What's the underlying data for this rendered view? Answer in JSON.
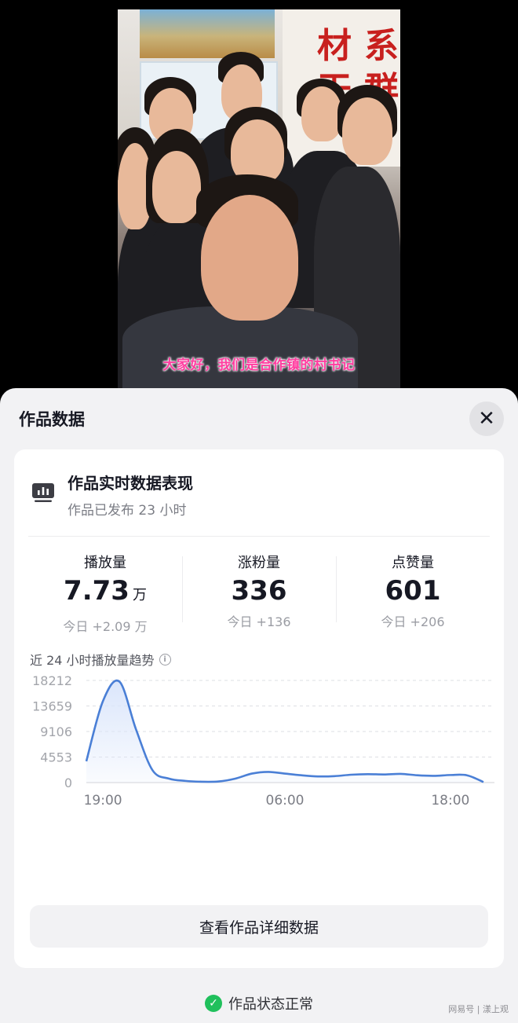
{
  "video": {
    "subtitle": "大家好，我们是合作镇的村书记"
  },
  "sheet": {
    "title": "作品数据",
    "close_icon": "close-icon"
  },
  "card": {
    "icon": "bar-chart-icon",
    "title": "作品实时数据表现",
    "subtitle": "作品已发布 23 小时"
  },
  "metrics": [
    {
      "label": "播放量",
      "value": "7.73",
      "unit": "万",
      "today": "今日 +2.09 万"
    },
    {
      "label": "涨粉量",
      "value": "336",
      "unit": "",
      "today": "今日 +136"
    },
    {
      "label": "点赞量",
      "value": "601",
      "unit": "",
      "today": "今日 +206"
    }
  ],
  "trend": {
    "label": "近 24 小时播放量趋势",
    "info_icon": "info-icon"
  },
  "chart_data": {
    "type": "area",
    "title": "",
    "xlabel": "",
    "ylabel": "",
    "y_ticks": [
      "18212",
      "13659",
      "9106",
      "4553",
      "0"
    ],
    "y_tick_values": [
      18212,
      13659,
      9106,
      4553,
      0
    ],
    "x_ticks": [
      "19:00",
      "06:00",
      "18:00"
    ],
    "x_tick_index": [
      1,
      12,
      22
    ],
    "ylim": [
      0,
      18212
    ],
    "grid": true,
    "line_color": "#4a7fd6",
    "fill_color": "#dbe6fb",
    "series": [
      {
        "values": [
          3800,
          14500,
          18000,
          9500,
          2200,
          700,
          300,
          150,
          200,
          700,
          1600,
          1900,
          1600,
          1300,
          1100,
          1150,
          1400,
          1500,
          1450,
          1550,
          1300,
          1200,
          1350,
          1300,
          100
        ]
      }
    ]
  },
  "detail_button": {
    "label": "查看作品详细数据"
  },
  "status": {
    "icon": "check-circle-icon",
    "text": "作品状态正常"
  },
  "watermark": "网易号 | 漾上观"
}
